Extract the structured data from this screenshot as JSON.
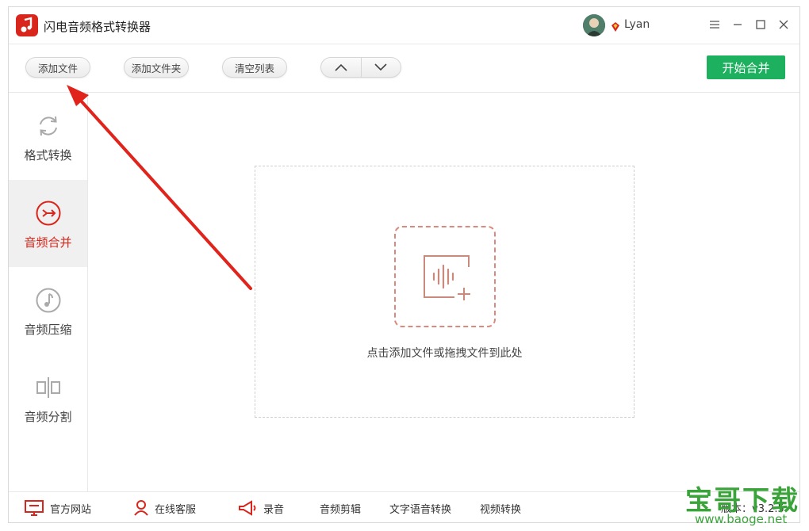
{
  "app": {
    "title": "闪电音频格式转换器",
    "username": "Lyan"
  },
  "toolbar": {
    "add_file": "添加文件",
    "add_folder": "添加文件夹",
    "clear_list": "清空列表",
    "start": "开始合并"
  },
  "sidebar": {
    "items": [
      {
        "label": "格式转换",
        "icon": "refresh-icon",
        "active": false
      },
      {
        "label": "音频合并",
        "icon": "merge-icon",
        "active": true
      },
      {
        "label": "音频压缩",
        "icon": "music-note-icon",
        "active": false
      },
      {
        "label": "音频分割",
        "icon": "split-icon",
        "active": false
      }
    ]
  },
  "dropzone": {
    "text": "点击添加文件或拖拽文件到此处"
  },
  "bottombar": {
    "website": "官方网站",
    "support": "在线客服",
    "record": "录音",
    "audio_edit": "音频剪辑",
    "tts": "文字语音转换",
    "video_convert": "视频转换",
    "version": "版本：v3.2.5"
  },
  "watermark": {
    "text": "宝哥下载",
    "url": "www.baoge.net"
  },
  "colors": {
    "accent": "#d9261c",
    "start": "#1db15f",
    "dropzone_icon": "#d98a7c"
  }
}
